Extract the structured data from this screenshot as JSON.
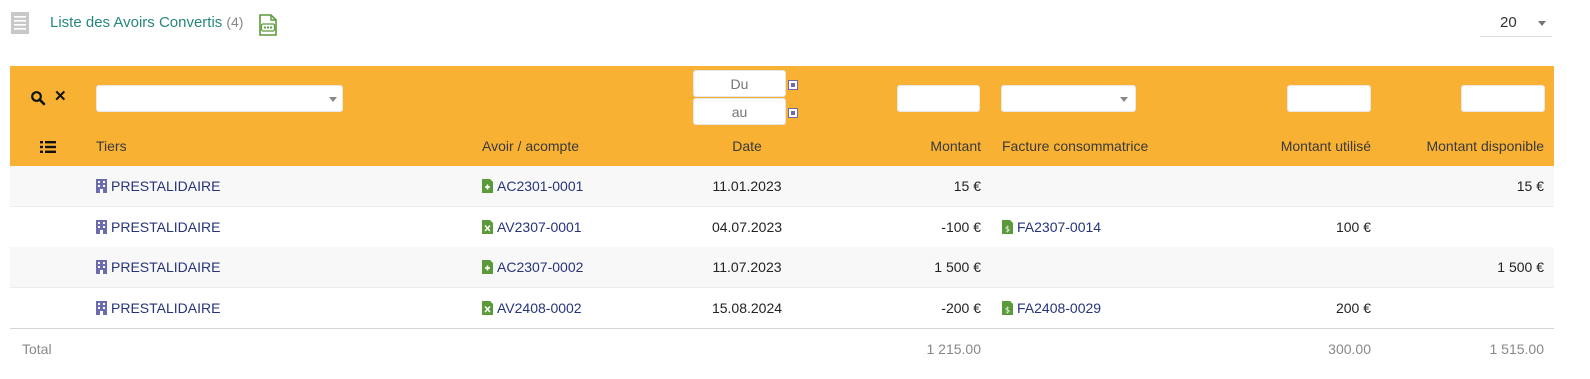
{
  "header": {
    "title": "Liste des Avoirs Convertis",
    "count": "(4)",
    "page_size": "20"
  },
  "filters": {
    "date_from_placeholder": "Du",
    "date_to_placeholder": "au"
  },
  "columns": {
    "tiers": "Tiers",
    "avoir": "Avoir / acompte",
    "date": "Date",
    "montant": "Montant",
    "facture": "Facture consommatrice",
    "montant_utilise": "Montant utilisé",
    "montant_disponible": "Montant disponible"
  },
  "rows": [
    {
      "tiers": "PRESTALIDAIRE",
      "avoir": "AC2301-0001",
      "avoir_kind": "acompte",
      "date": "11.01.2023",
      "montant": "15 €",
      "facture": "",
      "montant_utilise": "",
      "montant_disponible": "15 €"
    },
    {
      "tiers": "PRESTALIDAIRE",
      "avoir": "AV2307-0001",
      "avoir_kind": "avoir",
      "date": "04.07.2023",
      "montant": "-100 €",
      "facture": "FA2307-0014",
      "montant_utilise": "100 €",
      "montant_disponible": ""
    },
    {
      "tiers": "PRESTALIDAIRE",
      "avoir": "AC2307-0002",
      "avoir_kind": "acompte",
      "date": "11.07.2023",
      "montant": "1 500 €",
      "facture": "",
      "montant_utilise": "",
      "montant_disponible": "1 500 €"
    },
    {
      "tiers": "PRESTALIDAIRE",
      "avoir": "AV2408-0002",
      "avoir_kind": "avoir",
      "date": "15.08.2024",
      "montant": "-200 €",
      "facture": "FA2408-0029",
      "montant_utilise": "200 €",
      "montant_disponible": ""
    }
  ],
  "totals": {
    "label": "Total",
    "montant": "1 215.00",
    "montant_utilise": "300.00",
    "montant_disponible": "1 515.00"
  },
  "colors": {
    "header_bg": "#f8b133",
    "title": "#26877e",
    "link": "#26347a",
    "doc_icon": "#5a9a3a",
    "company_icon": "#6b6bb0"
  }
}
